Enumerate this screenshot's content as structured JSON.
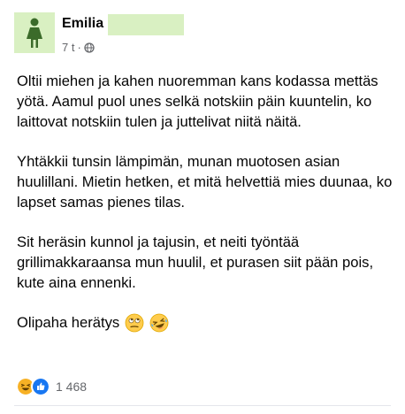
{
  "author": {
    "name": "Emilia"
  },
  "meta": {
    "time": "7 t",
    "separator": "·"
  },
  "post": {
    "paragraphs": [
      "Oltii miehen ja kahen nuoremman kans kodassa mettäs yötä. Aamul puol unes selkä notskiin päin kuuntelin, ko laittovat notskiin tulen ja juttelivat niitä näitä.",
      "Yhtäkkii tunsin lämpimän, munan muotosen asian huulillani. Mietin hetken, et mitä helvettiä mies duunaa, ko lapset samas pienes tilas.",
      "Sit heräsin kunnol ja tajusin, et neiti työntää grillimakkaraansa mun huulil, et purasen siit pään pois, kute aina ennenki."
    ],
    "closing": "Olipaha herätys"
  },
  "reactions": {
    "count": "1 468"
  },
  "colors": {
    "avatar_bg": "#d9f0c2",
    "avatar_icon": "#3b6b2a",
    "like": "#1877f2",
    "haha": "#f7b125"
  },
  "icons": [
    "person-silhouette-icon",
    "globe-icon",
    "eye-roll-emoji",
    "laughing-emoji",
    "haha-reaction-icon",
    "like-reaction-icon"
  ]
}
